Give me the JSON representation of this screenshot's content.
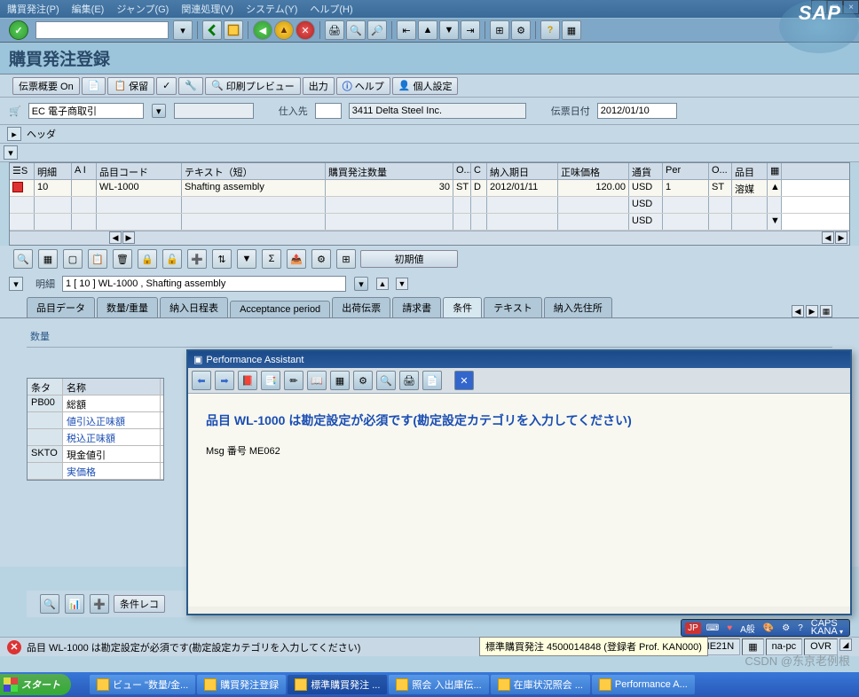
{
  "menu": {
    "po": "購買発注(P)",
    "edit": "編集(E)",
    "jump": "ジャンプ(G)",
    "rel": "関連処理(V)",
    "sys": "システム(Y)",
    "help": "ヘルプ(H)"
  },
  "screen_title": "購買発注登録",
  "app_toolbar": {
    "doc_overview": "伝票概要 On",
    "hold": "保留",
    "print_preview": "印刷プレビュー",
    "output": "出力",
    "help": "ヘルプ",
    "personal": "個人設定"
  },
  "header": {
    "doc_type_label": "EC 電子商取引",
    "vendor_label": "仕入先",
    "vendor_value": "3411 Delta Steel Inc.",
    "date_label": "伝票日付",
    "date_value": "2012/01/10",
    "header_tab": "ヘッダ"
  },
  "grid": {
    "cols": {
      "s": "S",
      "item": "明細",
      "ai": "A I",
      "mat": "品目コード",
      "txt": "テキスト（短）",
      "qty": "購買発注数量",
      "o": "O...",
      "c": "C",
      "date": "納入期日",
      "price": "正味価格",
      "curr": "通貨",
      "per": "Per",
      "o2": "O...",
      "mat2": "品目"
    },
    "rows": [
      {
        "item": "10",
        "mat": "WL-1000",
        "txt": "Shafting assembly",
        "qty": "30",
        "o": "ST",
        "c": "D",
        "date": "2012/01/11",
        "price": "120.00",
        "curr": "USD",
        "per": "1",
        "o2": "ST",
        "mat2": "溶媒"
      },
      {
        "curr": "USD"
      },
      {
        "curr": "USD"
      }
    ]
  },
  "item_toolbar": {
    "default": "初期値"
  },
  "detail": {
    "label": "明細",
    "combo": "1 [ 10 ] WL-1000 , Shafting assembly",
    "tabs": {
      "mat": "品目データ",
      "qty": "数量/重量",
      "sched": "納入日程表",
      "accept": "Acceptance period",
      "ship": "出荷伝票",
      "inv": "請求書",
      "cond": "条件",
      "text": "テキスト",
      "addr": "納入先住所"
    },
    "section": "数量",
    "cond_cols": {
      "key": "条タ",
      "name": "名称"
    },
    "conds": [
      {
        "key": "PB00",
        "name": "総額",
        "link": false
      },
      {
        "key": "",
        "name": "値引込正味額",
        "link": true
      },
      {
        "key": "",
        "name": "税込正味額",
        "link": true
      },
      {
        "key": "SKTO",
        "name": "現金値引",
        "link": false
      },
      {
        "key": "",
        "name": "実価格",
        "link": true
      }
    ],
    "cond_record": "条件レコ"
  },
  "perf_assist": {
    "title": "Performance Assistant",
    "message": "品目 WL-1000 は勘定設定が必須です(勘定設定カテゴリを入力してください)",
    "msg_no": "Msg 番号 ME062"
  },
  "status": {
    "error_msg": "品目 WL-1000 は勘定設定が必須です(勘定設定カテゴリを入力してください)",
    "tcode": "ME21N",
    "host": "na-pc",
    "mode": "OVR"
  },
  "tooltip": "標準購買発注 4500014848 (登録者 Prof. KAN000)",
  "ime": {
    "lang": "JP",
    "mode": "A般",
    "caps": "CAPS",
    "kana": "KANA"
  },
  "taskbar": {
    "start": "スタート",
    "items": [
      "ビュー \"数量/金...",
      "購買発注登録",
      "標準購買発注 ...",
      "照会 入出庫伝...",
      "在庫状況照会 ...",
      "Performance A..."
    ],
    "active_index": 2
  },
  "watermark": "CSDN @东京老例根"
}
